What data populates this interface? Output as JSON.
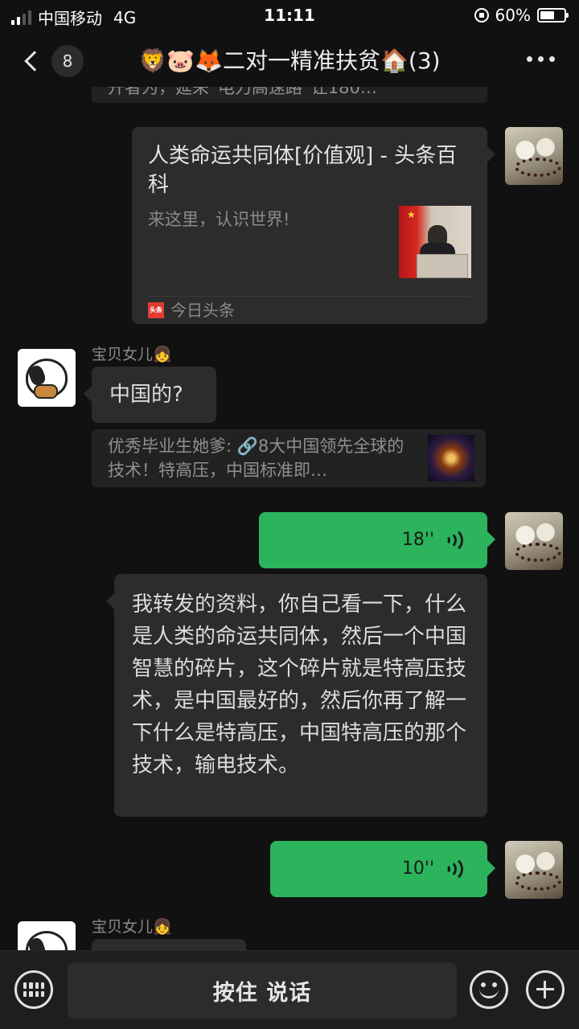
{
  "status_bar": {
    "carrier": "中国移动",
    "network": "4G",
    "time": "11:11",
    "battery": "60%",
    "battery_level": 0.6
  },
  "header": {
    "back_count": "8",
    "title": "🦁🐷🦊二对一精准扶贫🏠(3)"
  },
  "messages": {
    "top_quote": "开者为，延来“电力高速路”让180…",
    "link_card": {
      "title": "人类命运共同体[价值观] - 头条百科",
      "description": "来这里，认识世界!",
      "source_badge": "头条",
      "source": "今日头条"
    },
    "sender1": "宝贝女儿👧",
    "msg_question": "中国的?",
    "quote2": "优秀毕业生她爹: 🔗8大中国领先全球的技术！特高压，中国标准即…",
    "voice1": "18''",
    "long_text": "我转发的资料，你自己看一下，什么是人类的命运共同体，然后一个中国智慧的碎片，这个碎片就是特高压技术，是中国最好的，然后你再了解一下什么是特高压，中国特高压的那个技术，输电技术。",
    "voice2": "10''",
    "sender2": "宝贝女儿👧"
  },
  "input": {
    "hold_to_talk": "按住 说话"
  },
  "colors": {
    "background": "#111111",
    "bubble_out": "#2bb45b",
    "bubble_in": "#2c2c2c"
  }
}
